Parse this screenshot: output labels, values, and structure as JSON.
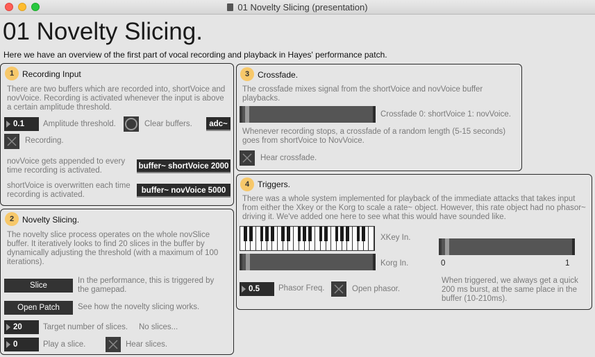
{
  "window": {
    "title": "01 Novelty Slicing (presentation)"
  },
  "header": {
    "title": "01 Novelty Slicing.",
    "subtitle": "Here we have an overview of the first part of vocal recording and playback in Hayes' performance patch."
  },
  "panel1": {
    "number": "1",
    "title": "Recording Input",
    "description": "There are two buffers which are recorded into, shortVoice and novVoice. Recording is activated whenever the input is above a certain amplitude threshold.",
    "threshold_value": "0.1",
    "threshold_label": "Amplitude threshold.",
    "clear_label": "Clear buffers.",
    "adc_label": "adc~",
    "recording_label": "Recording.",
    "nov_desc": "novVoice gets appended to every time recording is activated.",
    "nov_buffer": "buffer~ shortVoice 2000",
    "short_desc": "shortVoice is overwritten each time recording is activated.",
    "short_buffer": "buffer~ novVoice 5000"
  },
  "panel2": {
    "number": "2",
    "title": "Novelty Slicing.",
    "description": "The novelty slice process operates on the whole novSlice buffer. It iteratively looks to find 20 slices in the buffer by dynamically adjusting the threshold (with a maximum of 100 iterations).",
    "slice_button": "Slice",
    "slice_desc": "In the performance, this is triggered by the gamepad.",
    "open_patch_button": "Open Patch",
    "open_patch_desc": "See how the novelty slicing works.",
    "target_value": "20",
    "target_label": "Target number of slices.",
    "no_slices": "No slices...",
    "play_value": "0",
    "play_label": "Play a slice.",
    "hear_label": "Hear slices."
  },
  "panel3": {
    "number": "3",
    "title": "Crossfade.",
    "description": "The crossfade mixes signal from the shortVoice and novVoice buffer playbacks.",
    "crossfade_label": "Crossfade 0: shortVoice 1: novVoice.",
    "crossfade_position": 0.02,
    "recording_desc": "Whenever recording stops, a crossfade of a random length (5-15 seconds) goes from shortVoice to NovVoice.",
    "hear_label": "Hear crossfade."
  },
  "panel4": {
    "number": "4",
    "title": "Triggers.",
    "description": "There was a whole system implemented for playback of the immediate attacks that takes input from either the Xkey or the Korg to scale a rate~ object. However, this rate object had no phasor~ driving it. We've added one here to see what this would have sounded like.",
    "xkey_label": "XKey In.",
    "korg_label": "Korg In.",
    "korg_position": 0.03,
    "range_min": "0",
    "range_max": "1",
    "range_position": 0.03,
    "phasor_value": "0.5",
    "phasor_label": "Phasor Freq.",
    "open_phasor_label": "Open phasor.",
    "trigger_desc": "When triggered, we always get a quick 200 ms burst, at the same place in the buffer (10-210ms)."
  },
  "colors": {
    "background": "#e5e5e5",
    "badge": "#f7c86a",
    "control_dark": "#2b2b2b",
    "text_muted": "#7a7a7a"
  },
  "icons": {
    "toggle": "x-toggle-icon",
    "bang": "bang-circle-icon",
    "numbox": "triangle-right-icon"
  }
}
